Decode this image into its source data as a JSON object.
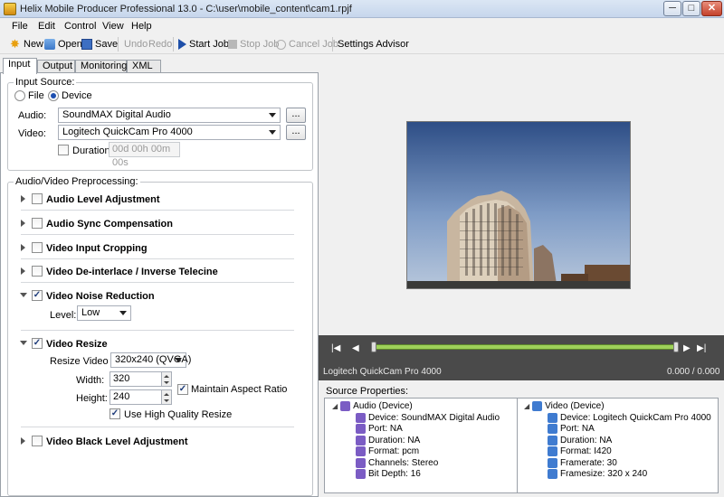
{
  "window": {
    "title": "Helix Mobile Producer Professional 13.0 - C:\\user\\mobile_content\\cam1.rpjf",
    "minimize": "─",
    "maximize": "□",
    "close": "✕"
  },
  "menu": [
    "File",
    "Edit",
    "Control",
    "View",
    "Help"
  ],
  "toolbar": {
    "new": "New",
    "open": "Open",
    "save": "Save",
    "undo": "Undo",
    "redo": "Redo",
    "start_job": "Start Job",
    "stop_job": "Stop Job",
    "cancel_job": "Cancel Job",
    "settings_advisor": "Settings Advisor"
  },
  "tabs": [
    "Input",
    "Output",
    "Monitoring",
    "XML"
  ],
  "input_source": {
    "group_label": "Input Source:",
    "file_label": "File",
    "device_label": "Device",
    "selected": "Device",
    "audio_label": "Audio:",
    "audio_value": "SoundMAX Digital Audio",
    "video_label": "Video:",
    "video_value": "Logitech QuickCam Pro 4000",
    "browse": "...",
    "duration_label": "Duration",
    "duration_value": "00d 00h 00m 00s"
  },
  "preprocessing": {
    "group_label": "Audio/Video Preprocessing:",
    "sections": {
      "audio_level": "Audio Level Adjustment",
      "audio_sync": "Audio Sync Compensation",
      "video_crop": "Video Input Cropping",
      "deinterlace": "Video De-interlace / Inverse Telecine",
      "noise": "Video Noise Reduction",
      "resize": "Video Resize",
      "black_level": "Video Black Level  Adjustment"
    },
    "noise_level_label": "Level:",
    "noise_level_value": "Low",
    "resize_to_label": "Resize Video to:",
    "resize_to_value": "320x240 (QVGA)",
    "width_label": "Width:",
    "width_value": "320",
    "height_label": "Height:",
    "height_value": "240",
    "maintain_aspect": "Maintain Aspect Ratio",
    "high_quality": "Use High Quality Resize",
    "check_mark": "✓"
  },
  "player": {
    "device_name": "Logitech QuickCam Pro 4000",
    "time": "0.000 / 0.000",
    "progress": 0
  },
  "source_properties": {
    "label": "Source Properties:",
    "audio_title": "Audio (Device)",
    "audio_items": [
      "Device: SoundMAX Digital Audio",
      "Port: NA",
      "Duration: NA",
      "Format: pcm",
      "Channels: Stereo",
      "Bit Depth: 16"
    ],
    "video_title": "Video (Device)",
    "video_items": [
      "Device: Logitech QuickCam Pro 4000",
      "Port: NA",
      "Duration: NA",
      "Format: I420",
      "Framerate: 30",
      "Framesize: 320 x 240"
    ]
  }
}
